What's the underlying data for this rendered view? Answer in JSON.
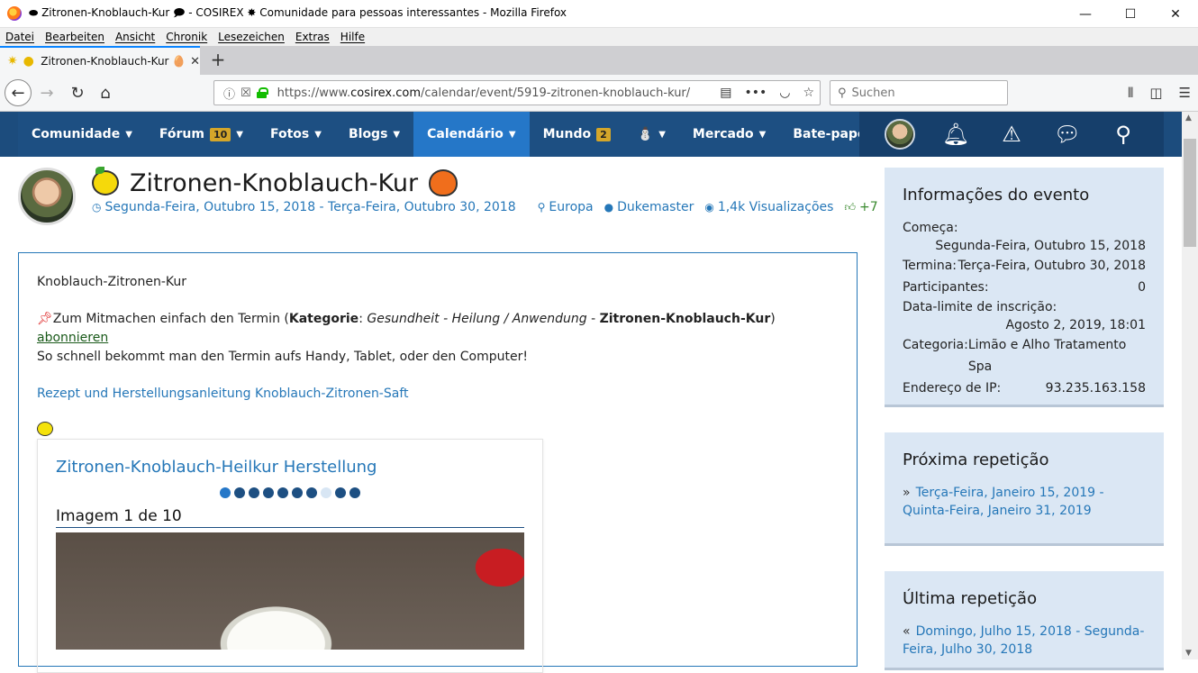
{
  "window": {
    "title": "⬬ Zitronen-Knoblauch-Kur 🗩 - COSIREX ✸ Comunidade para pessoas interessantes - Mozilla Firefox",
    "minimize": "—",
    "maximize": "☐",
    "close": "✕"
  },
  "menu": [
    "Datei",
    "Bearbeiten",
    "Ansicht",
    "Chronik",
    "Lesezeichen",
    "Extras",
    "Hilfe"
  ],
  "tab": {
    "title": "Zitronen-Knoblauch-Kur 🥚",
    "close": "✕",
    "new": "+"
  },
  "nav": {
    "url_prefix": "https://www.",
    "url_domain": "cosirex.com",
    "url_path": "/calendar/event/5919-zitronen-knoblauch-kur/",
    "search_placeholder": "Suchen"
  },
  "site_nav": [
    {
      "label": "Comunidade",
      "caret": true
    },
    {
      "label": "Fórum",
      "badge": "10",
      "caret": true
    },
    {
      "label": "Fotos",
      "caret": true
    },
    {
      "label": "Blogs",
      "caret": true
    },
    {
      "label": "Calendário",
      "caret": true,
      "active": true
    },
    {
      "label": "Mundo",
      "badge": "2"
    },
    {
      "label": "⛄",
      "caret": true
    },
    {
      "label": "Mercado",
      "caret": true
    },
    {
      "label": "Bate-papo"
    }
  ],
  "event": {
    "title": "Zitronen-Knoblauch-Kur",
    "dates": "Segunda-Feira, Outubro 15, 2018 - Terça-Feira, Outubro 30, 2018",
    "location": "Europa",
    "author": "Dukemaster",
    "views": "1,4k Visualizações",
    "likes": "+7"
  },
  "body": {
    "intro": "Knoblauch-Zitronen-Kur",
    "line1_pre": "Zum Mitmachen einfach den Termin (",
    "kategorie_label": "Kategorie",
    "kategorie_value": "Gesundheit - Heilung / Anwendung",
    "dash": " - ",
    "kategorie_sub": "Zitronen-Knoblauch-Kur",
    "line1_post": ") ",
    "subscribe": "abonnieren",
    "line2": "So schnell bekommt man den Termin aufs Handy, Tablet, oder den Computer!",
    "recipe_link": "Rezept und Herstellungsanleitung Knoblauch-Zitronen-Saft",
    "gallery_title": "Zitronen-Knoblauch-Heilkur Herstellung",
    "gallery_caption": "Imagem 1 de 10",
    "gallery_total": 10,
    "gallery_current": 1
  },
  "sidebar": {
    "info_title": "Informações do evento",
    "starts_label": "Começa:",
    "starts_value": "Segunda-Feira, Outubro 15, 2018",
    "ends_label": "Termina:",
    "ends_value": "Terça-Feira, Outubro 30, 2018",
    "participants_label": "Participantes:",
    "participants_value": "0",
    "deadline_label": "Data-limite de inscrição:",
    "deadline_value": "Agosto 2, 2019, 18:01",
    "category_label": "Categoria:",
    "category_value": "Limão e Alho Tratamento Spa",
    "ip_label": "Endereço de IP:",
    "ip_value": "93.235.163.158",
    "next_title": "Próxima repetição",
    "next_link": "Terça-Feira, Janeiro 15, 2019 - Quinta-Feira, Janeiro 31, 2019",
    "last_title": "Última repetição",
    "last_link": "Domingo, Julho 15, 2018 - Segunda-Feira, Julho 30, 2018"
  }
}
